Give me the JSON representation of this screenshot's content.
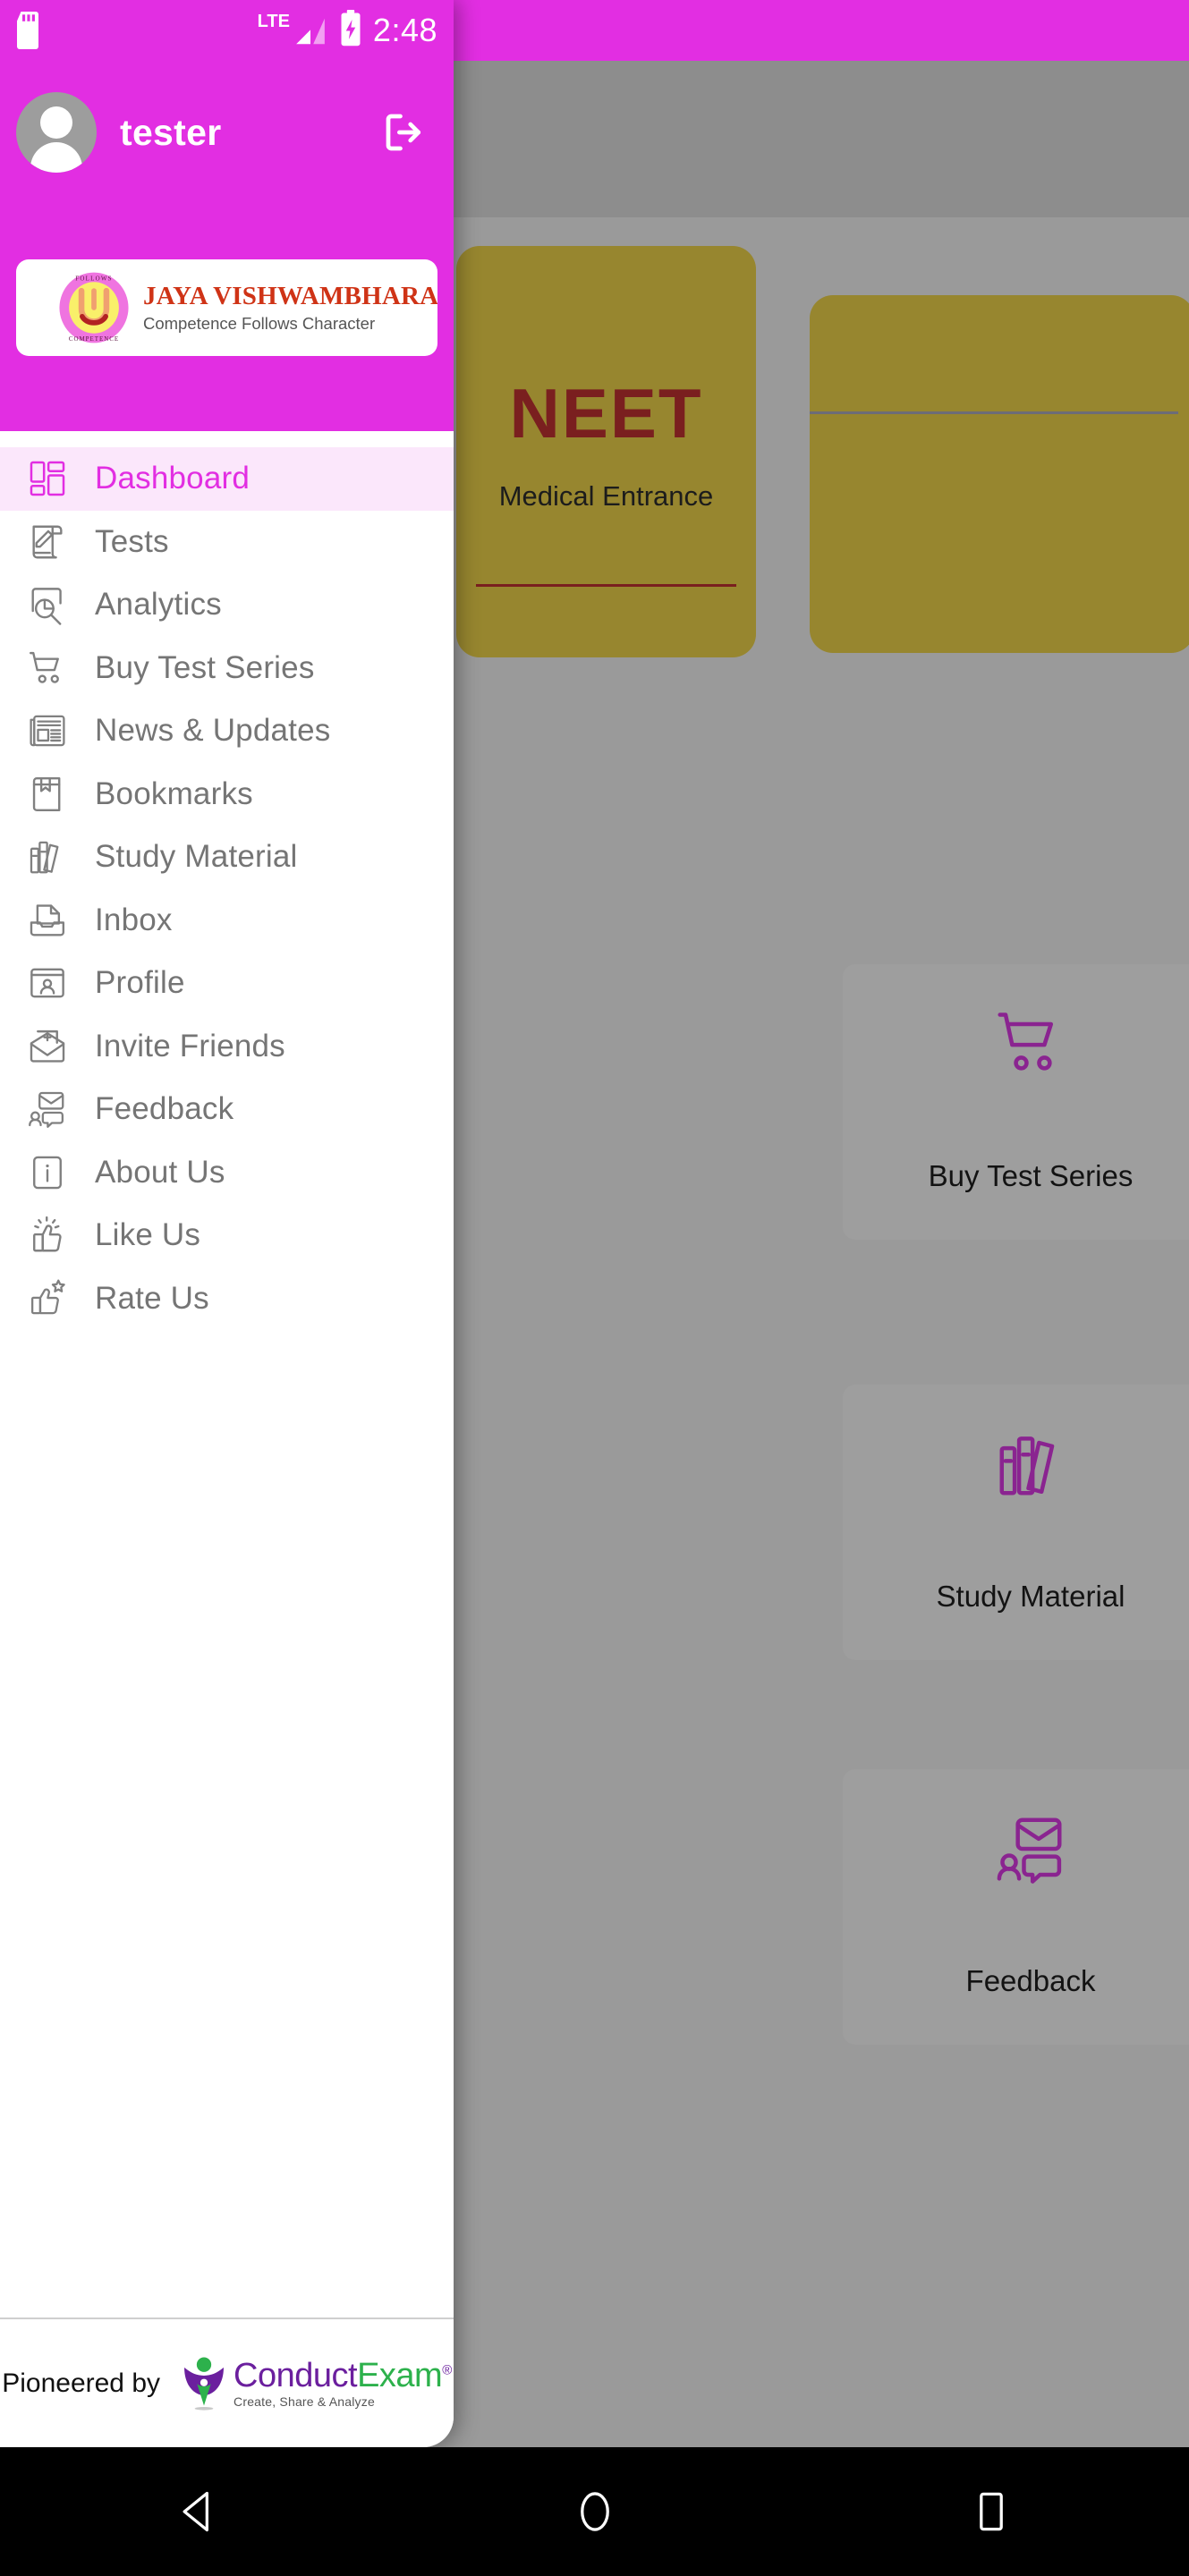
{
  "status_bar": {
    "sd_icon": "sd-card-icon",
    "network_label": "LTE",
    "signal_icon": "signal-bars-icon",
    "battery_icon": "battery-charging-icon",
    "time": "2:48"
  },
  "drawer": {
    "profile": {
      "avatar_icon": "avatar-placeholder-icon",
      "username": "tester",
      "logout_icon": "logout-icon"
    },
    "brand_banner": {
      "emblem_icon": "jaya-vishwambhara-emblem-icon",
      "emblem_ring_text": "COMPETENCE FOLLOWS CHARACTER",
      "name": "JAYA VISHWAMBHARA CLASSES",
      "tagline": "Competence Follows Character"
    },
    "menu_items": [
      {
        "label": "Dashboard",
        "icon": "dashboard-grid-icon",
        "active": true
      },
      {
        "label": "Tests",
        "icon": "test-paper-pen-icon",
        "active": false
      },
      {
        "label": "Analytics",
        "icon": "analytics-search-icon",
        "active": false
      },
      {
        "label": "Buy Test Series",
        "icon": "shopping-cart-icon",
        "active": false
      },
      {
        "label": "News & Updates",
        "icon": "newspaper-icon",
        "active": false
      },
      {
        "label": "Bookmarks",
        "icon": "bookmark-book-icon",
        "active": false
      },
      {
        "label": "Study Material",
        "icon": "books-stack-icon",
        "active": false
      },
      {
        "label": "Inbox",
        "icon": "inbox-tray-icon",
        "active": false
      },
      {
        "label": "Profile",
        "icon": "profile-card-icon",
        "active": false
      },
      {
        "label": "Invite Friends",
        "icon": "envelope-plus-icon",
        "active": false
      },
      {
        "label": "Feedback",
        "icon": "feedback-chat-icon",
        "active": false
      },
      {
        "label": "About Us",
        "icon": "info-box-icon",
        "active": false
      },
      {
        "label": "Like Us",
        "icon": "thumbs-up-icon",
        "active": false
      },
      {
        "label": "Rate Us",
        "icon": "thumbs-up-star-icon",
        "active": false
      }
    ],
    "footer": {
      "pioneered_text": "Pioneered by",
      "logo_icon": "conductexam-logo-icon",
      "brand_part1": "Conduct",
      "brand_part2": "Exam",
      "registered_mark": "®",
      "brand_tagline": "Create, Share & Analyze"
    }
  },
  "background": {
    "exam_cards": [
      {
        "title": "NEET",
        "subtitle": "Medical Entrance"
      }
    ],
    "tiles": [
      {
        "label": "Buy Test Series",
        "icon": "shopping-cart-icon"
      },
      {
        "label": "Study Material",
        "icon": "books-stack-icon"
      },
      {
        "label": "Feedback",
        "icon": "feedback-chat-icon"
      }
    ]
  },
  "nav_bar": {
    "back_icon": "back-triangle-icon",
    "home_icon": "home-circle-icon",
    "recents_icon": "recents-square-icon"
  },
  "colors": {
    "brand_magenta": "#e22ee2",
    "active_row": "#fbe7fb",
    "menu_text": "#757575",
    "card_gold": "#97862f"
  }
}
